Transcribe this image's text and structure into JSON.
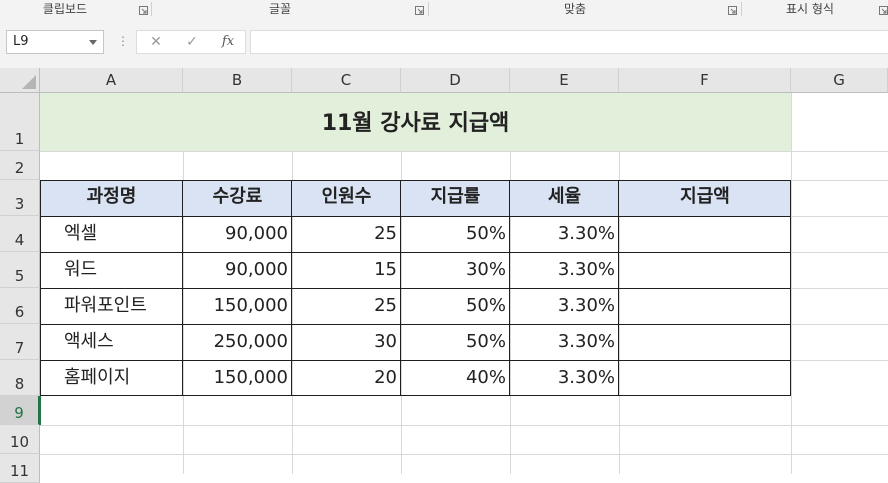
{
  "ribbon": {
    "groups": [
      "클립보드",
      "글꼴",
      "맞춤",
      "표시 형식"
    ]
  },
  "formula_bar": {
    "name_box": "L9",
    "cancel_glyph": "✕",
    "enter_glyph": "✓",
    "fx_label": "fx",
    "formula": ""
  },
  "sheet": {
    "columns": [
      "A",
      "B",
      "C",
      "D",
      "E",
      "F",
      "G"
    ],
    "rows": [
      "1",
      "2",
      "3",
      "4",
      "5",
      "6",
      "7",
      "8",
      "9",
      "10",
      "11"
    ],
    "selected_row": "9",
    "title": "11월 강사료 지급액",
    "table_headers": [
      "과정명",
      "수강료",
      "인원수",
      "지급률",
      "세율",
      "지급액"
    ],
    "table_rows": [
      [
        "엑셀",
        "90,000",
        "25",
        "50%",
        "3.30%",
        ""
      ],
      [
        "워드",
        "90,000",
        "15",
        "30%",
        "3.30%",
        ""
      ],
      [
        "파워포인트",
        "150,000",
        "25",
        "50%",
        "3.30%",
        ""
      ],
      [
        "액세스",
        "250,000",
        "30",
        "50%",
        "3.30%",
        ""
      ],
      [
        "홈페이지",
        "150,000",
        "20",
        "40%",
        "3.30%",
        ""
      ]
    ]
  },
  "colors": {
    "title_fill": "#e2efda",
    "header_fill": "#dae3f3",
    "selection": "#217346"
  }
}
